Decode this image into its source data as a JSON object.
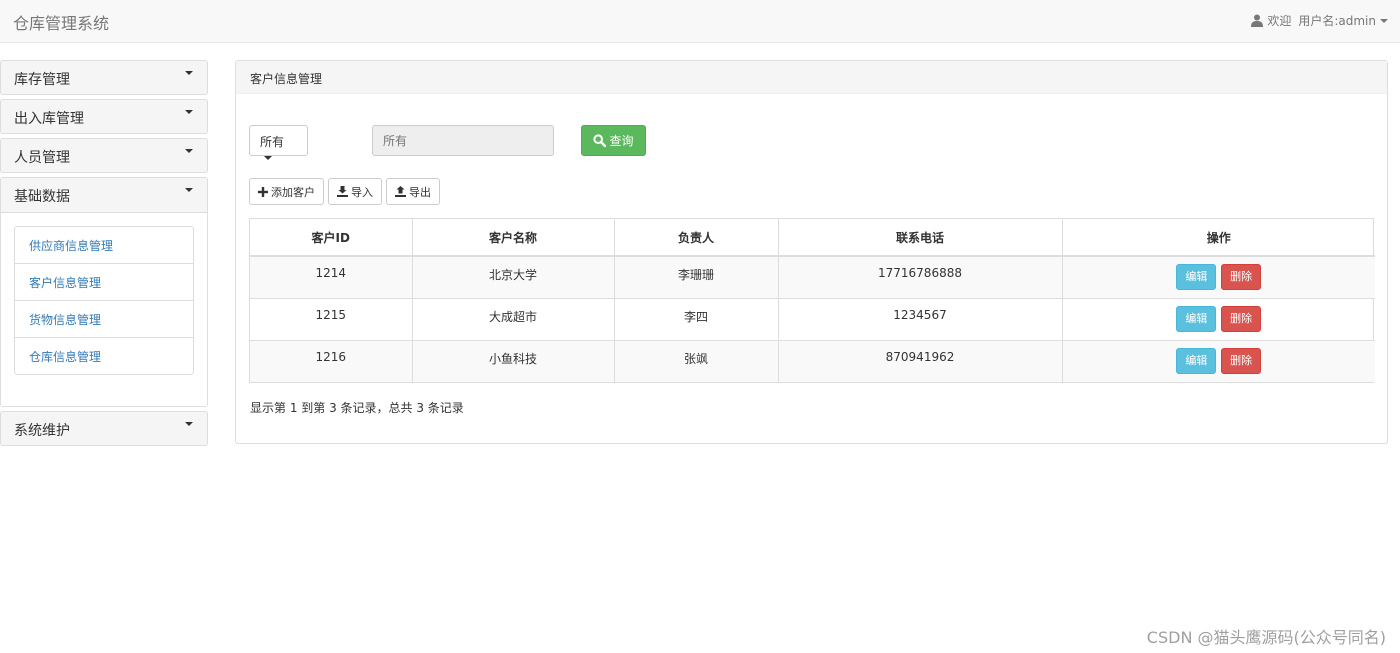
{
  "navbar": {
    "brand": "仓库管理系统",
    "welcome": "欢迎",
    "username": "用户名:admin"
  },
  "sidebar": {
    "items": [
      {
        "label": "库存管理"
      },
      {
        "label": "出入库管理"
      },
      {
        "label": "人员管理"
      },
      {
        "label": "基础数据"
      },
      {
        "label": "系统维护"
      }
    ],
    "submenu": [
      {
        "label": "供应商信息管理"
      },
      {
        "label": "客户信息管理"
      },
      {
        "label": "货物信息管理"
      },
      {
        "label": "仓库信息管理"
      }
    ]
  },
  "main": {
    "title": "客户信息管理",
    "filter_label": "所有",
    "search_placeholder": "所有",
    "query_label": "查询",
    "add_label": "添加客户",
    "import_label": "导入",
    "export_label": "导出",
    "table": {
      "headers": [
        "客户ID",
        "客户名称",
        "负责人",
        "联系电话",
        "操作"
      ],
      "rows": [
        {
          "id": "1214",
          "name": "北京大学",
          "person": "李珊珊",
          "phone": "17716786888"
        },
        {
          "id": "1215",
          "name": "大成超市",
          "person": "李四",
          "phone": "1234567"
        },
        {
          "id": "1216",
          "name": "小鱼科技",
          "person": "张飒",
          "phone": "870941962"
        }
      ],
      "edit_label": "编辑",
      "delete_label": "删除"
    },
    "summary": "显示第 1 到第 3 条记录，总共 3 条记录"
  },
  "watermark": "CSDN @猫头鹰源码(公众号同名)"
}
